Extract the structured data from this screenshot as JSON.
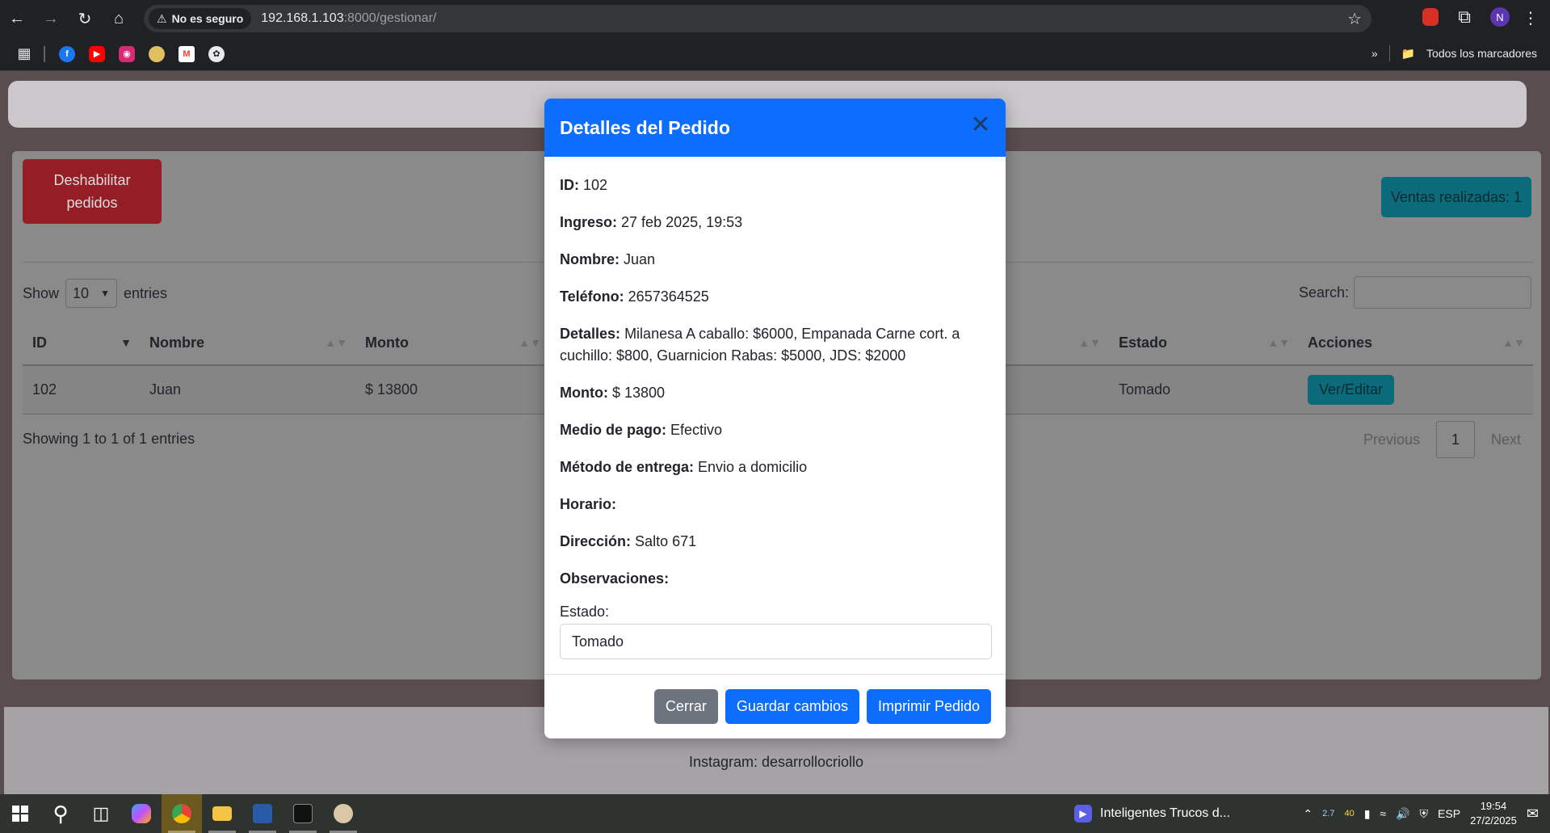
{
  "browser": {
    "security_label": "No es seguro",
    "url_host": "192.168.1.103",
    "url_path": ":8000/gestionar/",
    "profile_initial": "N",
    "bookmarks_folder": "Todos los marcadores"
  },
  "page": {
    "disable_button": "Deshabilitar pedidos",
    "ventas_badge": "Ventas realizadas: 1",
    "show_label": "Show",
    "entries_select": "10",
    "entries_label": "entries",
    "search_label": "Search:",
    "table": {
      "columns": [
        "ID",
        "Nombre",
        "Monto",
        "Estado",
        "Acciones"
      ],
      "rows": [
        {
          "id": "102",
          "nombre": "Juan",
          "monto": "$ 13800",
          "estado": "Tomado",
          "accion": "Ver/Editar"
        }
      ]
    },
    "showing_text": "Showing 1 to 1 of 1 entries",
    "pagination": {
      "previous": "Previous",
      "current": "1",
      "next": "Next"
    },
    "footer_text": "Instagram: desarrollocriollo"
  },
  "modal": {
    "title": "Detalles del Pedido",
    "fields": {
      "id": {
        "label": "ID:",
        "value": "102"
      },
      "ingreso": {
        "label": "Ingreso:",
        "value": "27 feb 2025, 19:53"
      },
      "nombre": {
        "label": "Nombre:",
        "value": "Juan"
      },
      "telefono": {
        "label": "Teléfono:",
        "value": "2657364525"
      },
      "detalles": {
        "label": "Detalles:",
        "value": "Milanesa A caballo: $6000, Empanada Carne cort. a cuchillo: $800, Guarnicion Rabas: $5000, JDS: $2000"
      },
      "monto": {
        "label": "Monto:",
        "value": "$ 13800"
      },
      "medio_pago": {
        "label": "Medio de pago:",
        "value": "Efectivo"
      },
      "metodo_entrega": {
        "label": "Método de entrega:",
        "value": "Envio a domicilio"
      },
      "horario": {
        "label": "Horario:",
        "value": ""
      },
      "direccion": {
        "label": "Dirección:",
        "value": "Salto 671"
      },
      "observaciones": {
        "label": "Observaciones:",
        "value": ""
      }
    },
    "estado_label": "Estado:",
    "estado_value": "Tomado",
    "buttons": {
      "close": "Cerrar",
      "save": "Guardar cambios",
      "print": "Imprimir Pedido"
    }
  },
  "taskbar": {
    "media_title": "Inteligentes Trucos d...",
    "tray_values": [
      "2.7",
      "40"
    ],
    "language": "ESP",
    "time": "19:54",
    "date": "27/2/2025"
  },
  "colors": {
    "primary": "#0d6efd",
    "danger_dim": "#951d26",
    "info_dim": "#0b6b7a",
    "secondary": "#6c757d"
  }
}
